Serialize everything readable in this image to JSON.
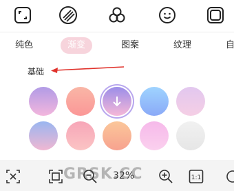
{
  "toolbar": {
    "icons": [
      "crop-icon",
      "gradient-icon",
      "color-circles-icon",
      "emoji-icon",
      "frame-icon"
    ],
    "active": "gradient-icon"
  },
  "tabs": [
    {
      "label": "纯色"
    },
    {
      "label": "渐变",
      "active": true
    },
    {
      "label": "图案"
    },
    {
      "label": "纹理"
    },
    {
      "label": "自"
    }
  ],
  "section": {
    "label": "基础"
  },
  "swatches": [
    {
      "colors": [
        "#b19be6",
        "#f3b6dd"
      ]
    },
    {
      "colors": [
        "#f9b6a6",
        "#fb9797"
      ]
    },
    {
      "colors": [
        "#9b8de9",
        "#f6b7d7"
      ],
      "selected": true
    },
    {
      "colors": [
        "#9fd4ff",
        "#8aa9f7"
      ]
    },
    {
      "colors": [
        "#e2c7ef",
        "#f5cfe5"
      ]
    },
    {
      "colors": [
        "#9ab6f0",
        "#f0b7d2"
      ]
    },
    {
      "colors": [
        "#f7a6b8",
        "#fbc4c4"
      ]
    },
    {
      "colors": [
        "#fbc79a",
        "#f7a28f"
      ]
    },
    {
      "colors": [
        "#f6b9ea",
        "#fbd0ee"
      ]
    },
    {
      "colors": [
        "#f1f1f1",
        "#e6e6e6"
      ]
    }
  ],
  "bottombar": {
    "zoom": "32%",
    "icons": [
      "remove-background-icon",
      "fit-screen-icon",
      "zoom-out-icon",
      "zoom-in-icon",
      "actual-size-icon"
    ]
  },
  "watermark": "GRSK.CC"
}
